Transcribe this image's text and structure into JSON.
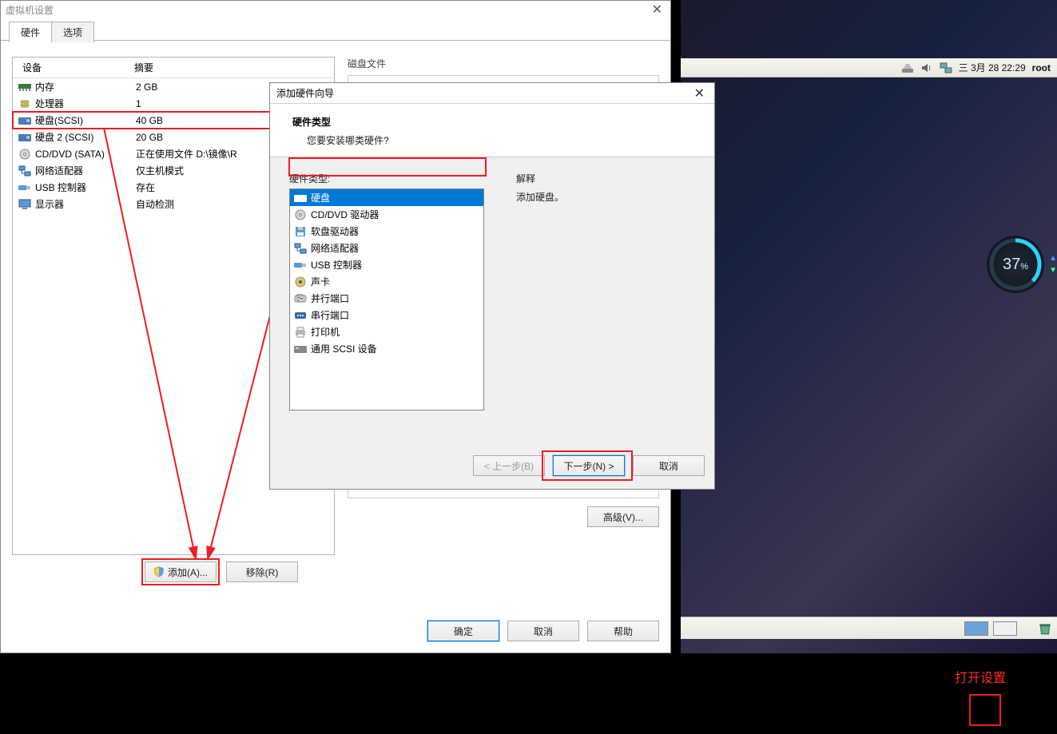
{
  "vm_desktop": {
    "topbar": {
      "datetime": "三 3月 28 22:29",
      "user": "root"
    },
    "progress": {
      "value": "37",
      "unit": "%"
    }
  },
  "settings_window": {
    "title": "虚拟机设置",
    "tabs": {
      "hardware": "硬件",
      "options": "选项"
    },
    "columns": {
      "device": "设备",
      "summary": "摘要"
    },
    "devices": [
      {
        "name": "内存",
        "summary": "2 GB",
        "icon": "memory-icon"
      },
      {
        "name": "处理器",
        "summary": "1",
        "icon": "cpu-icon"
      },
      {
        "name": "硬盘(SCSI)",
        "summary": "40 GB",
        "icon": "disk-icon",
        "highlight": true
      },
      {
        "name": "硬盘 2 (SCSI)",
        "summary": "20 GB",
        "icon": "disk-icon"
      },
      {
        "name": "CD/DVD (SATA)",
        "summary": "正在使用文件 D:\\镜像\\R",
        "icon": "cd-icon"
      },
      {
        "name": "网络适配器",
        "summary": "仅主机模式",
        "icon": "network-icon"
      },
      {
        "name": "USB 控制器",
        "summary": "存在",
        "icon": "usb-icon"
      },
      {
        "name": "显示器",
        "summary": "自动检测",
        "icon": "display-icon"
      }
    ],
    "right_section_title": "磁盘文件",
    "advanced_btn": "高级(V)...",
    "add_btn": "添加(A)...",
    "remove_btn": "移除(R)",
    "ok_btn": "确定",
    "cancel_btn": "取消",
    "help_btn": "帮助"
  },
  "wizard": {
    "title": "添加硬件向导",
    "header_title": "硬件类型",
    "header_sub": "您要安装哪类硬件?",
    "list_label": "硬件类型:",
    "items": [
      {
        "label": "硬盘",
        "icon": "disk-icon",
        "selected": true
      },
      {
        "label": "CD/DVD 驱动器",
        "icon": "cd-icon"
      },
      {
        "label": "软盘驱动器",
        "icon": "floppy-icon"
      },
      {
        "label": "网络适配器",
        "icon": "network-icon"
      },
      {
        "label": "USB 控制器",
        "icon": "usb-icon"
      },
      {
        "label": "声卡",
        "icon": "sound-icon"
      },
      {
        "label": "并行端口",
        "icon": "parallel-port-icon"
      },
      {
        "label": "串行端口",
        "icon": "serial-port-icon"
      },
      {
        "label": "打印机",
        "icon": "printer-icon"
      },
      {
        "label": "通用 SCSI 设备",
        "icon": "scsi-icon"
      }
    ],
    "explain_label": "解释",
    "explain_text": "添加硬盘。",
    "back_btn": "< 上一步(B)",
    "next_btn": "下一步(N) >",
    "cancel_btn": "取消"
  },
  "annotation": {
    "open_settings": "打开设置"
  }
}
